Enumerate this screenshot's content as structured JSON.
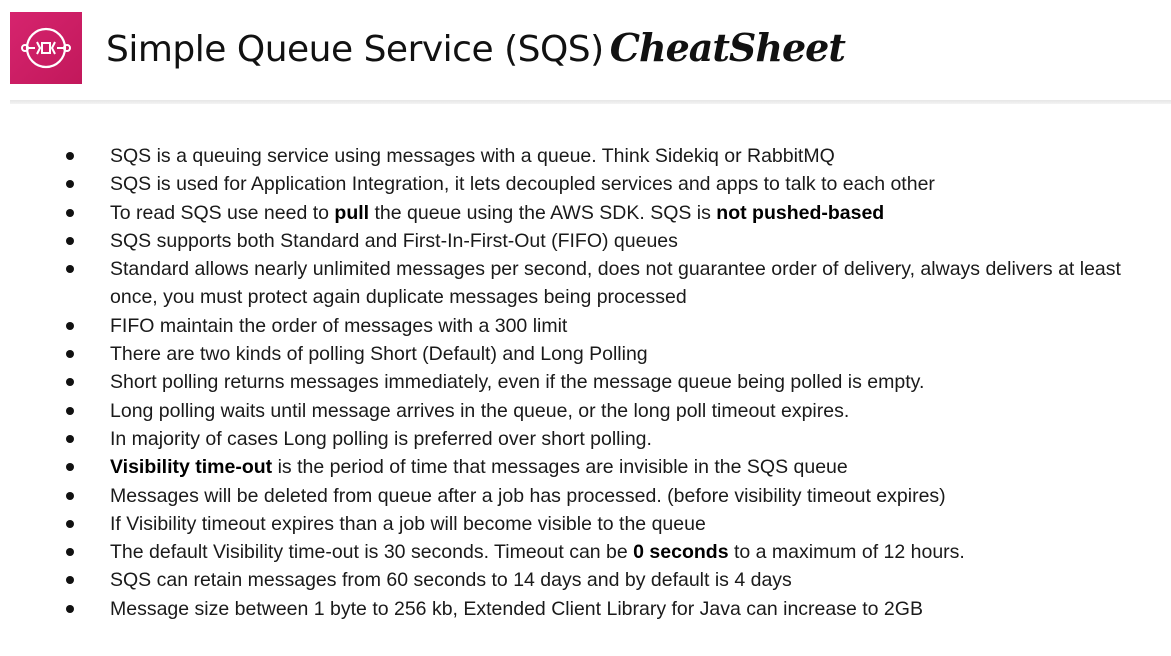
{
  "header": {
    "logo_icon": "sqs-queue-icon",
    "brand_color": "#d6246e",
    "title": "Simple Queue Service (SQS)",
    "title_script": "CheatSheet"
  },
  "bullets": [
    {
      "segments": [
        {
          "text": "SQS is a queuing service using messages with a queue. Think Sidekiq or RabbitMQ"
        }
      ]
    },
    {
      "segments": [
        {
          "text": "SQS is used for Application Integration, it lets decoupled services and apps to talk to each other"
        }
      ]
    },
    {
      "segments": [
        {
          "text": "To read SQS use need to "
        },
        {
          "text": "pull",
          "bold": true
        },
        {
          "text": " the queue using the AWS SDK. SQS is "
        },
        {
          "text": "not pushed-based",
          "bold": true
        }
      ]
    },
    {
      "segments": [
        {
          "text": "SQS supports both Standard and First-In-First-Out (FIFO) queues"
        }
      ]
    },
    {
      "segments": [
        {
          "text": "Standard allows nearly unlimited messages per second, does not guarantee order of delivery, always delivers at least once, you must protect again duplicate messages being processed"
        }
      ]
    },
    {
      "segments": [
        {
          "text": "FIFO maintain the order of messages with a 300 limit"
        }
      ]
    },
    {
      "segments": [
        {
          "text": "There are two kinds of polling Short (Default) and Long Polling"
        }
      ]
    },
    {
      "segments": [
        {
          "text": "Short polling returns messages immediately, even if the message queue being polled is empty."
        }
      ]
    },
    {
      "segments": [
        {
          "text": "Long polling waits until message arrives in the queue, or the long poll timeout expires."
        }
      ]
    },
    {
      "segments": [
        {
          "text": "In majority of cases Long polling is preferred over short polling."
        }
      ]
    },
    {
      "segments": [
        {
          "text": "Visibility time-out",
          "bold": true
        },
        {
          "text": " is the period of time that messages are invisible in the SQS queue"
        }
      ]
    },
    {
      "segments": [
        {
          "text": "Messages will be deleted from queue after a job has processed. (before visibility timeout expires)"
        }
      ]
    },
    {
      "segments": [
        {
          "text": "If Visibility timeout expires than a job will become visible to the queue"
        }
      ]
    },
    {
      "segments": [
        {
          "text": "The default Visibility time-out is 30 seconds. Timeout can be "
        },
        {
          "text": "0 seconds",
          "bold": true
        },
        {
          "text": " to a maximum of 12 hours."
        }
      ]
    },
    {
      "segments": [
        {
          "text": "SQS can retain messages from 60 seconds to 14 days and by default is 4 days"
        }
      ]
    },
    {
      "segments": [
        {
          "text": "Message size between 1 byte to 256 kb, Extended Client Library for Java can increase to 2GB"
        }
      ]
    }
  ]
}
